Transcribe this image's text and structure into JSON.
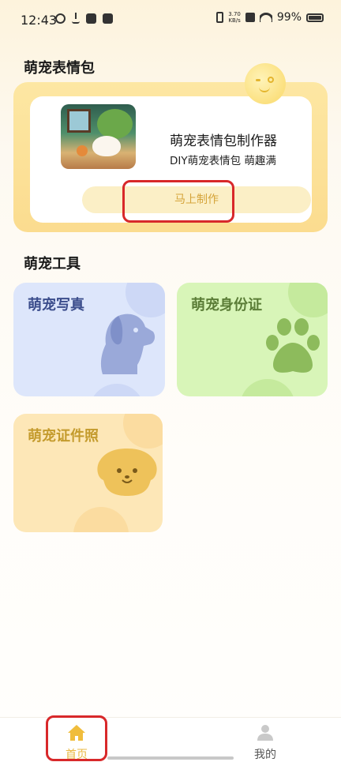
{
  "status_bar": {
    "time": "12:43",
    "net_speed_value": "3.70",
    "net_speed_unit": "KB/s",
    "battery": "99%"
  },
  "sections": {
    "meme_title": "萌宠表情包",
    "tools_title": "萌宠工具"
  },
  "meme_card": {
    "title": "萌宠表情包制作器",
    "subtitle": "DIY萌宠表情包 萌趣满",
    "button": "马上制作"
  },
  "tools": [
    {
      "label": "萌宠写真",
      "icon": "dog-head-icon",
      "color": "#dde6fb"
    },
    {
      "label": "萌宠身份证",
      "icon": "paw-icon",
      "color": "#d8f5b8"
    },
    {
      "label": "萌宠证件照",
      "icon": "puppy-face-icon",
      "color": "#fde7b7"
    }
  ],
  "bottom_nav": {
    "home": "首页",
    "mine": "我的",
    "active": "home",
    "accent": "#e9b840"
  },
  "highlight_color": "#d8282a"
}
